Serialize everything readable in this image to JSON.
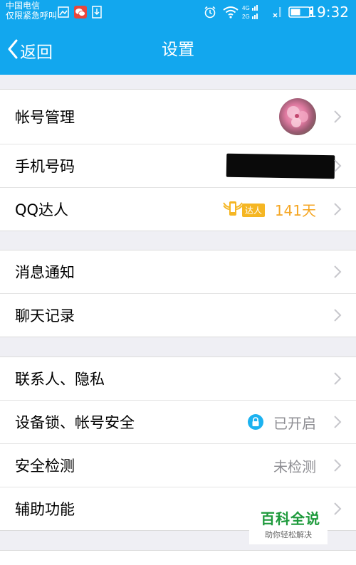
{
  "status_bar": {
    "carrier_line1": "中国电信",
    "carrier_line2": "仅限紧急呼叫",
    "time": "19:32",
    "signal_labels": [
      "4G",
      "2G"
    ],
    "icons": [
      "image-icon",
      "wechat-icon",
      "download-icon",
      "alarm-icon",
      "wifi-icon",
      "signal-icon",
      "battery-icon"
    ]
  },
  "nav": {
    "back_label": "返回",
    "title": "设置"
  },
  "groups": [
    {
      "rows": [
        {
          "label": "帐号管理"
        },
        {
          "label": "手机号码"
        },
        {
          "label": "QQ达人",
          "badge": "达人",
          "value": "141天"
        }
      ]
    },
    {
      "rows": [
        {
          "label": "消息通知"
        },
        {
          "label": "聊天记录"
        }
      ]
    },
    {
      "rows": [
        {
          "label": "联系人、隐私"
        },
        {
          "label": "设备锁、帐号安全",
          "value": "已开启"
        },
        {
          "label": "安全检测",
          "value": "未检测"
        },
        {
          "label": "辅助功能"
        }
      ]
    }
  ],
  "watermark": {
    "title": "百科全说",
    "subtitle": "助你轻松解决"
  },
  "colors": {
    "header": "#12a7ee",
    "background": "#efeff4",
    "accent_orange": "#f5a623",
    "watermark_green": "#1e9a3c"
  }
}
